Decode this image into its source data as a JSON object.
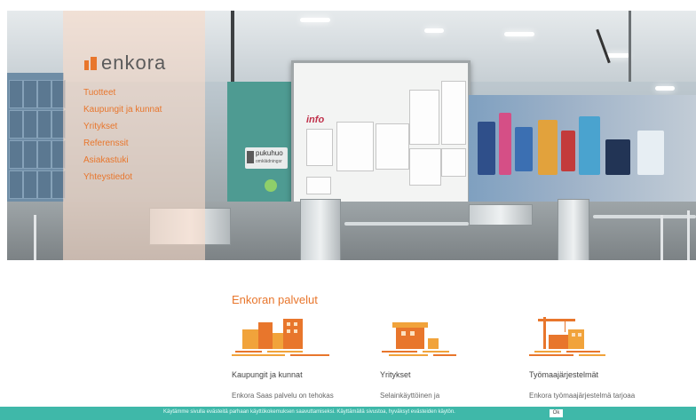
{
  "brand": {
    "name": "enkora",
    "color": "#e8762c"
  },
  "nav": {
    "items": [
      {
        "label": "Tuotteet"
      },
      {
        "label": "Kaupungit ja kunnat"
      },
      {
        "label": "Yritykset"
      },
      {
        "label": "Referenssit"
      },
      {
        "label": "Asiakastuki"
      },
      {
        "label": "Yhteystiedot"
      }
    ]
  },
  "hero": {
    "sign_text": "pukuhuo",
    "sign_subtext": "omklädningsr",
    "board_title": "info"
  },
  "services": {
    "title": "Enkoran palvelut",
    "cards": [
      {
        "title": "Kaupungit ja kunnat",
        "description": "Enkora Saas palvelu on tehokas",
        "icon": "city-buildings-icon"
      },
      {
        "title": "Yritykset",
        "description": "Selainkäyttöinen ja",
        "icon": "company-building-icon"
      },
      {
        "title": "Työmaajärjestelmät",
        "description": "Enkora työmaajärjestelmä tarjoaa",
        "icon": "construction-crane-icon"
      }
    ]
  },
  "cookie": {
    "text": "Käytämme sivulla evästeitä parhaan käyttökokemuksen saavuttamiseksi. Käyttämällä sivustoa, hyväksyt evästeiden käytön.",
    "ok_label": "Ok",
    "bar_color": "#3fb8a9"
  }
}
